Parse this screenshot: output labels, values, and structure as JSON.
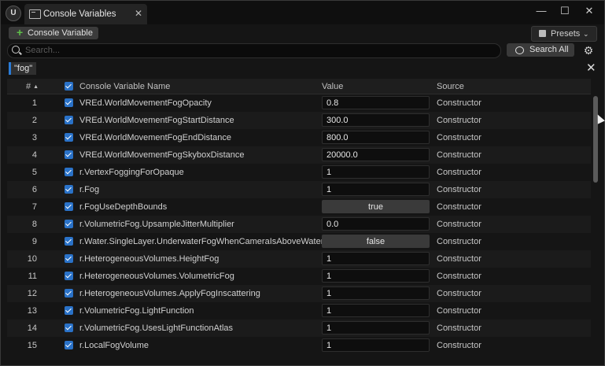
{
  "window": {
    "tab_title": "Console Variables",
    "tab_close": "✕",
    "minimize": "—",
    "maximize": "☐",
    "close": "✕"
  },
  "toolbar": {
    "add_label": "Console Variable",
    "presets_label": "Presets",
    "presets_chevron": "⌄"
  },
  "search": {
    "placeholder": "Search...",
    "value": "",
    "search_all_label": "Search All",
    "settings_icon": "⚙"
  },
  "filter": {
    "chip": "\"fog\"",
    "clear": "✕"
  },
  "table": {
    "headers": {
      "num": "#",
      "sort_indicator": "▲",
      "name": "Console Variable Name",
      "value": "Value",
      "source": "Source"
    },
    "rows": [
      {
        "num": "1",
        "name": "VREd.WorldMovementFogOpacity",
        "value": "0.8",
        "type": "text",
        "source": "Constructor"
      },
      {
        "num": "2",
        "name": "VREd.WorldMovementFogStartDistance",
        "value": "300.0",
        "type": "text",
        "source": "Constructor"
      },
      {
        "num": "3",
        "name": "VREd.WorldMovementFogEndDistance",
        "value": "800.0",
        "type": "text",
        "source": "Constructor"
      },
      {
        "num": "4",
        "name": "VREd.WorldMovementFogSkyboxDistance",
        "value": "20000.0",
        "type": "text",
        "source": "Constructor"
      },
      {
        "num": "5",
        "name": "r.VertexFoggingForOpaque",
        "value": "1",
        "type": "text",
        "source": "Constructor"
      },
      {
        "num": "6",
        "name": "r.Fog",
        "value": "1",
        "type": "text",
        "source": "Constructor"
      },
      {
        "num": "7",
        "name": "r.FogUseDepthBounds",
        "value": "true",
        "type": "bool",
        "source": "Constructor"
      },
      {
        "num": "8",
        "name": "r.VolumetricFog.UpsampleJitterMultiplier",
        "value": "0.0",
        "type": "text",
        "source": "Constructor"
      },
      {
        "num": "9",
        "name": "r.Water.SingleLayer.UnderwaterFogWhenCameraIsAboveWater",
        "value": "false",
        "type": "bool",
        "source": "Constructor"
      },
      {
        "num": "10",
        "name": "r.HeterogeneousVolumes.HeightFog",
        "value": "1",
        "type": "text",
        "source": "Constructor"
      },
      {
        "num": "11",
        "name": "r.HeterogeneousVolumes.VolumetricFog",
        "value": "1",
        "type": "text",
        "source": "Constructor"
      },
      {
        "num": "12",
        "name": "r.HeterogeneousVolumes.ApplyFogInscattering",
        "value": "1",
        "type": "text",
        "source": "Constructor"
      },
      {
        "num": "13",
        "name": "r.VolumetricFog.LightFunction",
        "value": "1",
        "type": "text",
        "source": "Constructor"
      },
      {
        "num": "14",
        "name": "r.VolumetricFog.UsesLightFunctionAtlas",
        "value": "1",
        "type": "text",
        "source": "Constructor"
      },
      {
        "num": "15",
        "name": "r.LocalFogVolume",
        "value": "1",
        "type": "text",
        "source": "Constructor"
      }
    ]
  },
  "colors": {
    "accent": "#2a72c8",
    "add_icon": "#5fbf4a"
  }
}
